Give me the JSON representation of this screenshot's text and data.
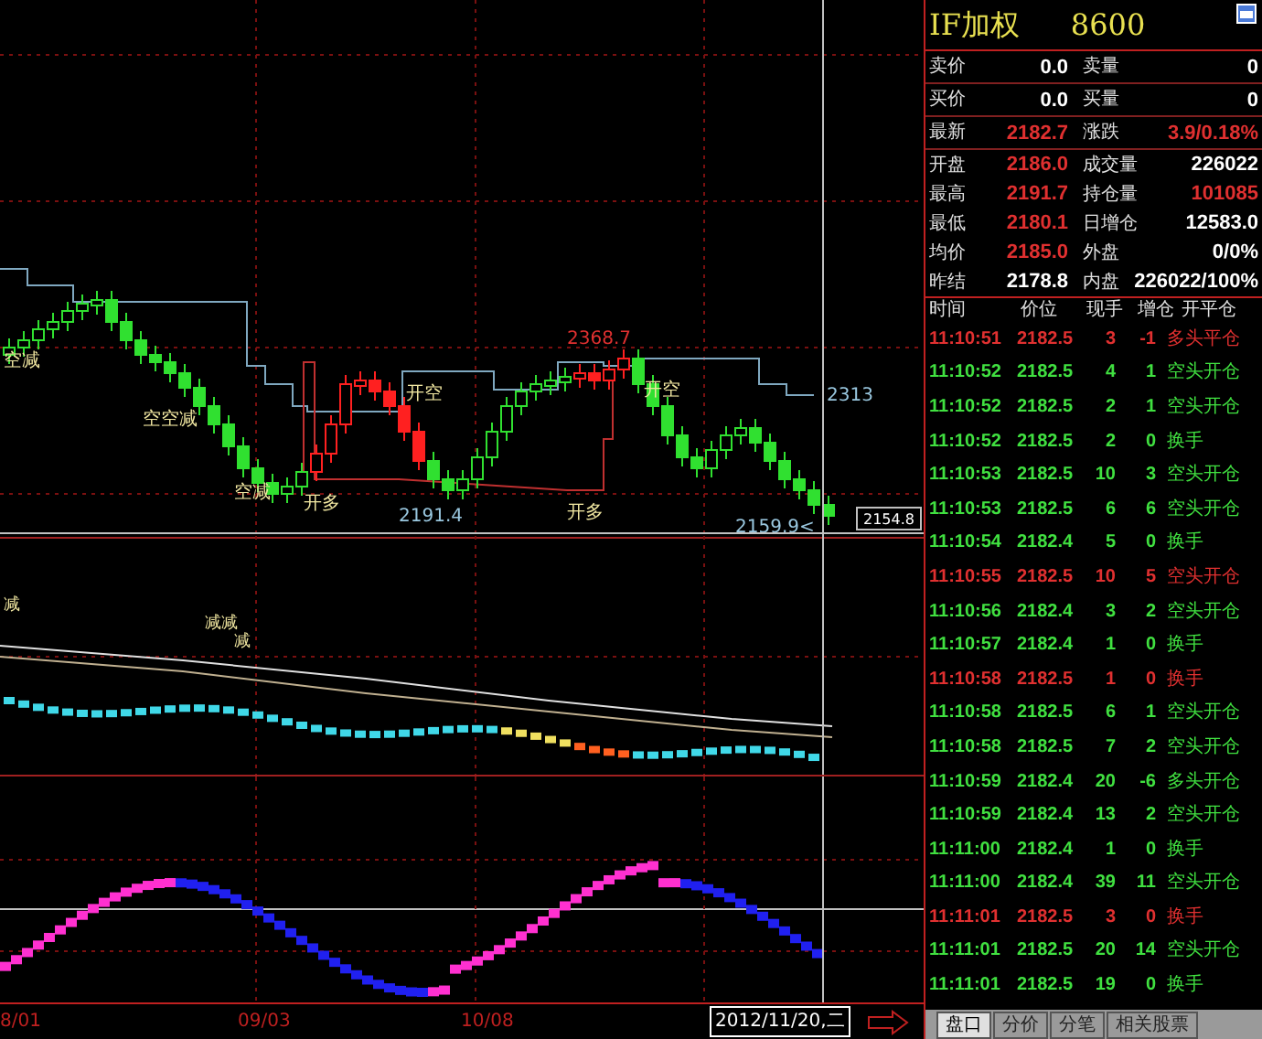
{
  "main_chart": {
    "labels": [
      "空减",
      "空空减",
      "空减",
      "开多",
      "2191.4",
      "开空",
      "2368.7",
      "开空",
      "开多",
      "2159.9<",
      "2313"
    ],
    "price_tag": "2154.8"
  },
  "indicator_chart": {
    "labels": [
      "减",
      "减减",
      "减"
    ]
  },
  "x_axis": {
    "dates": [
      "8/01",
      "09/03",
      "10/08"
    ],
    "cursor_date": "2012/11/20,二"
  },
  "quote": {
    "symbol": "IF加权",
    "code": "8600",
    "rows": [
      [
        {
          "label": "卖价",
          "value": "0.0",
          "color": "#ffffff"
        },
        {
          "label": "卖量",
          "value": "0",
          "color": "#ffffff"
        }
      ],
      [
        {
          "label": "买价",
          "value": "0.0",
          "color": "#ffffff"
        },
        {
          "label": "买量",
          "value": "0",
          "color": "#ffffff"
        }
      ],
      [
        {
          "label": "最新",
          "value": "2182.7",
          "color": "#e03030"
        },
        {
          "label": "涨跌",
          "value": "3.9/0.18%",
          "color": "#e03030"
        }
      ],
      [
        {
          "label": "开盘",
          "value": "2186.0",
          "color": "#e03030"
        },
        {
          "label": "成交量",
          "value": "226022",
          "color": "#ffffff"
        }
      ],
      [
        {
          "label": "最高",
          "value": "2191.7",
          "color": "#e03030"
        },
        {
          "label": "持仓量",
          "value": "101085",
          "color": "#e03030"
        }
      ],
      [
        {
          "label": "最低",
          "value": "2180.1",
          "color": "#e03030"
        },
        {
          "label": "日增仓",
          "value": "12583.0",
          "color": "#ffffff"
        }
      ],
      [
        {
          "label": "均价",
          "value": "2185.0",
          "color": "#e03030"
        },
        {
          "label": "外盘",
          "value": "0/0%",
          "color": "#ffffff"
        }
      ],
      [
        {
          "label": "昨结",
          "value": "2178.8",
          "color": "#ffffff"
        },
        {
          "label": "内盘",
          "value": "226022/100%",
          "color": "#ffffff"
        }
      ]
    ]
  },
  "trades": {
    "columns": [
      "时间",
      "价位",
      "现手",
      "增仓",
      "开平仓"
    ],
    "rows": [
      {
        "time": "11:10:51",
        "price": "2182.5",
        "volume": "3",
        "change": "-1",
        "type": "多头平仓",
        "color": "#e03030"
      },
      {
        "time": "11:10:52",
        "price": "2182.5",
        "volume": "4",
        "change": "1",
        "type": "空头开仓",
        "color": "#40e040"
      },
      {
        "time": "11:10:52",
        "price": "2182.5",
        "volume": "2",
        "change": "1",
        "type": "空头开仓",
        "color": "#40e040"
      },
      {
        "time": "11:10:52",
        "price": "2182.5",
        "volume": "2",
        "change": "0",
        "type": "换手",
        "color": "#40e040"
      },
      {
        "time": "11:10:53",
        "price": "2182.5",
        "volume": "10",
        "change": "3",
        "type": "空头开仓",
        "color": "#40e040"
      },
      {
        "time": "11:10:53",
        "price": "2182.5",
        "volume": "6",
        "change": "6",
        "type": "空头开仓",
        "color": "#40e040"
      },
      {
        "time": "11:10:54",
        "price": "2182.4",
        "volume": "5",
        "change": "0",
        "type": "换手",
        "color": "#40e040"
      },
      {
        "time": "11:10:55",
        "price": "2182.5",
        "volume": "10",
        "change": "5",
        "type": "空头开仓",
        "color": "#e03030"
      },
      {
        "time": "11:10:56",
        "price": "2182.4",
        "volume": "3",
        "change": "2",
        "type": "空头开仓",
        "color": "#40e040"
      },
      {
        "time": "11:10:57",
        "price": "2182.4",
        "volume": "1",
        "change": "0",
        "type": "换手",
        "color": "#40e040"
      },
      {
        "time": "11:10:58",
        "price": "2182.5",
        "volume": "1",
        "change": "0",
        "type": "换手",
        "color": "#e03030"
      },
      {
        "time": "11:10:58",
        "price": "2182.5",
        "volume": "6",
        "change": "1",
        "type": "空头开仓",
        "color": "#40e040"
      },
      {
        "time": "11:10:58",
        "price": "2182.5",
        "volume": "7",
        "change": "2",
        "type": "空头开仓",
        "color": "#40e040"
      },
      {
        "time": "11:10:59",
        "price": "2182.4",
        "volume": "20",
        "change": "-6",
        "type": "多头开仓",
        "color": "#40e040"
      },
      {
        "time": "11:10:59",
        "price": "2182.4",
        "volume": "13",
        "change": "2",
        "type": "空头开仓",
        "color": "#40e040"
      },
      {
        "time": "11:11:00",
        "price": "2182.4",
        "volume": "1",
        "change": "0",
        "type": "换手",
        "color": "#40e040"
      },
      {
        "time": "11:11:00",
        "price": "2182.4",
        "volume": "39",
        "change": "11",
        "type": "空头开仓",
        "color": "#40e040"
      },
      {
        "time": "11:11:01",
        "price": "2182.5",
        "volume": "3",
        "change": "0",
        "type": "换手",
        "color": "#e03030"
      },
      {
        "time": "11:11:01",
        "price": "2182.5",
        "volume": "20",
        "change": "14",
        "type": "空头开仓",
        "color": "#40e040"
      },
      {
        "time": "11:11:01",
        "price": "2182.5",
        "volume": "19",
        "change": "0",
        "type": "换手",
        "color": "#40e040"
      }
    ]
  },
  "tabs": [
    {
      "label": "盘口",
      "selected": true
    },
    {
      "label": "分价",
      "selected": false
    },
    {
      "label": "分笔",
      "selected": false
    },
    {
      "label": "相关股票",
      "selected": false
    }
  ]
}
